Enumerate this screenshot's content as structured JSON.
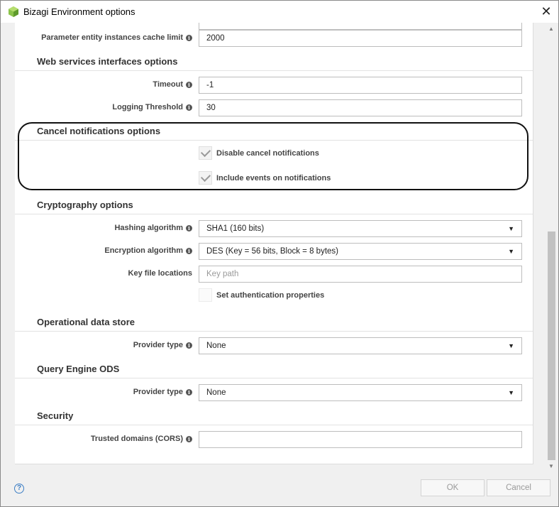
{
  "window": {
    "title": "Bizagi Environment options",
    "close_glyph": "✕",
    "app_icon": "bizagi-logo-icon"
  },
  "top_row": {
    "label": "Parameter entity instances cache limit",
    "value": "2000"
  },
  "web_services": {
    "title": "Web services interfaces options",
    "timeout_label": "Timeout",
    "timeout_value": "-1",
    "logging_label": "Logging Threshold",
    "logging_value": "30"
  },
  "cancel_notifications": {
    "title": "Cancel notifications options",
    "disable_label": "Disable cancel notifications",
    "disable_checked": true,
    "include_label": "Include events on notifications",
    "include_checked": true
  },
  "cryptography": {
    "title": "Cryptography options",
    "hashing_label": "Hashing algorithm",
    "hashing_value": "SHA1 (160 bits)",
    "encryption_label": "Encryption algorithm",
    "encryption_value": "DES (Key = 56 bits, Block = 8 bytes)",
    "keyfile_label": "Key file locations",
    "keyfile_placeholder": "Key path",
    "auth_label": "Set authentication properties",
    "auth_checked": false
  },
  "ods": {
    "title": "Operational data store",
    "provider_label": "Provider type",
    "provider_value": "None"
  },
  "query_engine": {
    "title": "Query Engine ODS",
    "provider_label": "Provider type",
    "provider_value": "None"
  },
  "security": {
    "title": "Security",
    "cors_label": "Trusted domains (CORS)",
    "cors_value": ""
  },
  "footer": {
    "ok_label": "OK",
    "cancel_label": "Cancel",
    "help_glyph": "?"
  },
  "glyphs": {
    "info": "i",
    "caret": "▼",
    "scroll_up": "▲",
    "scroll_down": "▼"
  },
  "colors": {
    "accent_help": "#3b7dc4",
    "highlight_border": "#111111"
  }
}
